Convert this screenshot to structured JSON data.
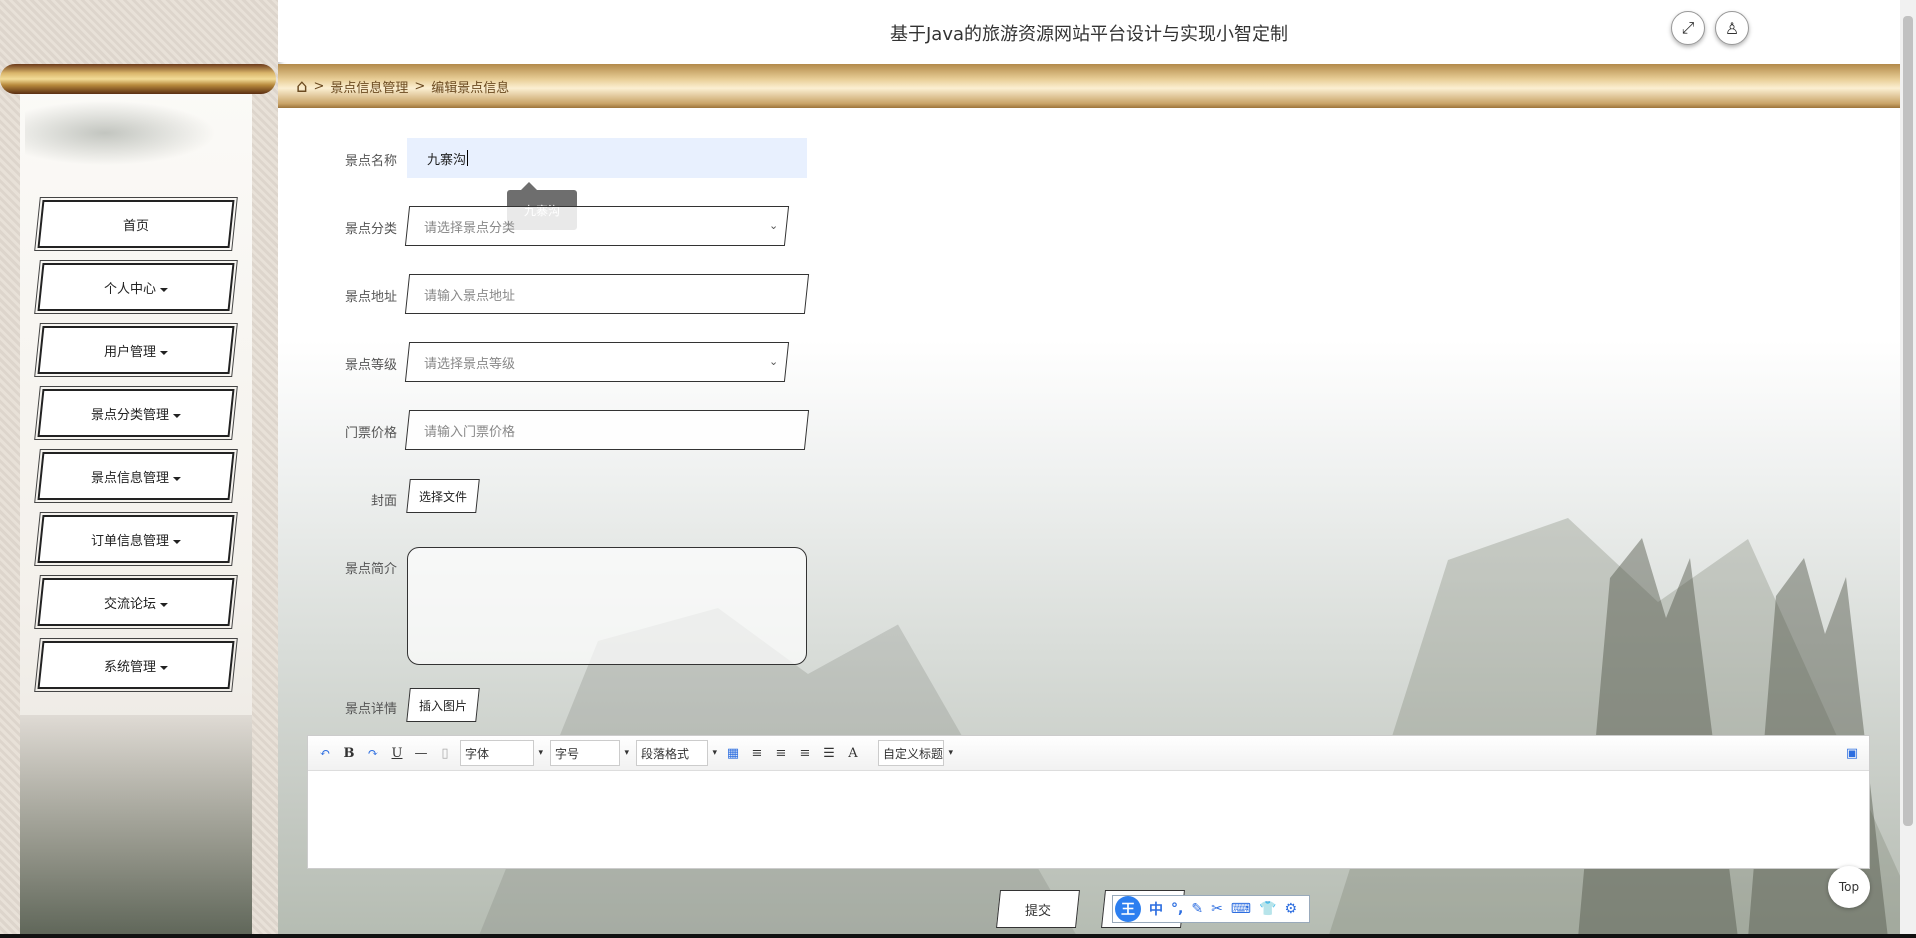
{
  "header": {
    "title": "基于Java的旅游资源网站平台设计与实现小智定制",
    "fullscreen_icon": "expand-icon",
    "user_icon": "user-icon"
  },
  "breadcrumb": {
    "sep": ">",
    "items": [
      "景点信息管理",
      "编辑景点信息"
    ]
  },
  "sidebar": {
    "items": [
      {
        "label": "首页",
        "caret": false
      },
      {
        "label": "个人中心",
        "caret": true
      },
      {
        "label": "用户管理",
        "caret": true
      },
      {
        "label": "景点分类管理",
        "caret": true
      },
      {
        "label": "景点信息管理",
        "caret": true
      },
      {
        "label": "订单信息管理",
        "caret": true
      },
      {
        "label": "交流论坛",
        "caret": true
      },
      {
        "label": "系统管理",
        "caret": true
      }
    ]
  },
  "form": {
    "name": {
      "label": "景点名称",
      "value": "九寨沟",
      "tooltip": "九寨沟"
    },
    "category": {
      "label": "景点分类",
      "placeholder": "请选择景点分类"
    },
    "address": {
      "label": "景点地址",
      "placeholder": "请输入景点地址"
    },
    "level": {
      "label": "景点等级",
      "placeholder": "请选择景点等级"
    },
    "price": {
      "label": "门票价格",
      "placeholder": "请输入门票价格"
    },
    "cover": {
      "label": "封面",
      "button": "选择文件"
    },
    "intro": {
      "label": "景点简介"
    },
    "detail": {
      "label": "景点详情",
      "button": "插入图片"
    }
  },
  "editor": {
    "font": "字体",
    "size": "字号",
    "paragraph": "段落格式",
    "custom_title": "自定义标题",
    "bold": "B",
    "underline": "U",
    "font_color": "A"
  },
  "actions": {
    "submit": "提交",
    "top": "Top"
  },
  "ime": {
    "logo": "王",
    "mode": "中"
  }
}
